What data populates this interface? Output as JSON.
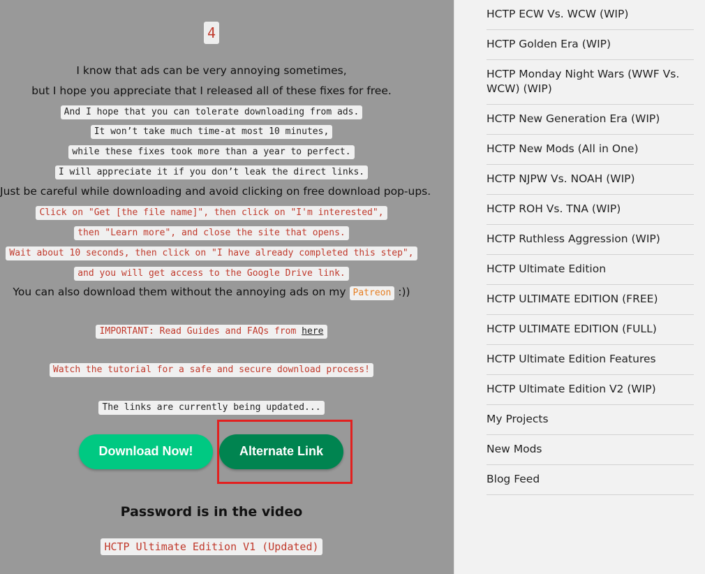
{
  "main": {
    "step_number": "4",
    "lines": [
      "I know that ads can be very annoying sometimes,",
      "but I hope you appreciate that I released all of these fixes for free.",
      "And I hope that you can tolerate downloading from ads.",
      "It won’t take much time-at most 10 minutes,",
      "while these fixes took more than a year to perfect.",
      "I will appreciate it if you don’t leak the direct links.",
      "Just be careful while downloading and avoid clicking on free download pop-ups.",
      "Click on \"Get [the file name]\", then click on \"I'm interested\",",
      "then \"Learn more\", and close the site that opens.",
      "Wait about 10 seconds, then click on \"I have already completed this step\",",
      "and you will get access to the Google Drive link."
    ],
    "patreon_line_before": "You can also download them without the annoying ads on my",
    "patreon_label": "Patreon",
    "patreon_line_after": ":))",
    "important_text": "IMPORTANT: Read Guides and FAQs from",
    "important_link": "here",
    "tutorial_text": "Watch the tutorial for a safe and secure download process!",
    "updating_text": "The links are currently being updated...",
    "download_button": "Download Now!",
    "alternate_button": "Alternate Link",
    "password_text": "Password is in the video",
    "file_title": "HCTP Ultimate Edition V1 (Updated)"
  },
  "sidebar": {
    "items": [
      "HCTP ECW Vs. WCW (WIP)",
      "HCTP Golden Era (WIP)",
      "HCTP Monday Night Wars (WWF Vs. WCW) (WIP)",
      "HCTP New Generation Era (WIP)",
      "HCTP New Mods (All in One)",
      "HCTP NJPW Vs. NOAH (WIP)",
      "HCTP ROH Vs. TNA (WIP)",
      "HCTP Ruthless Aggression (WIP)",
      "HCTP Ultimate Edition",
      "HCTP ULTIMATE EDITION (FREE)",
      "HCTP ULTIMATE EDITION (FULL)",
      "HCTP Ultimate Edition Features",
      "HCTP Ultimate Edition V2 (WIP)",
      "My Projects",
      "New Mods",
      "Blog Feed"
    ]
  }
}
